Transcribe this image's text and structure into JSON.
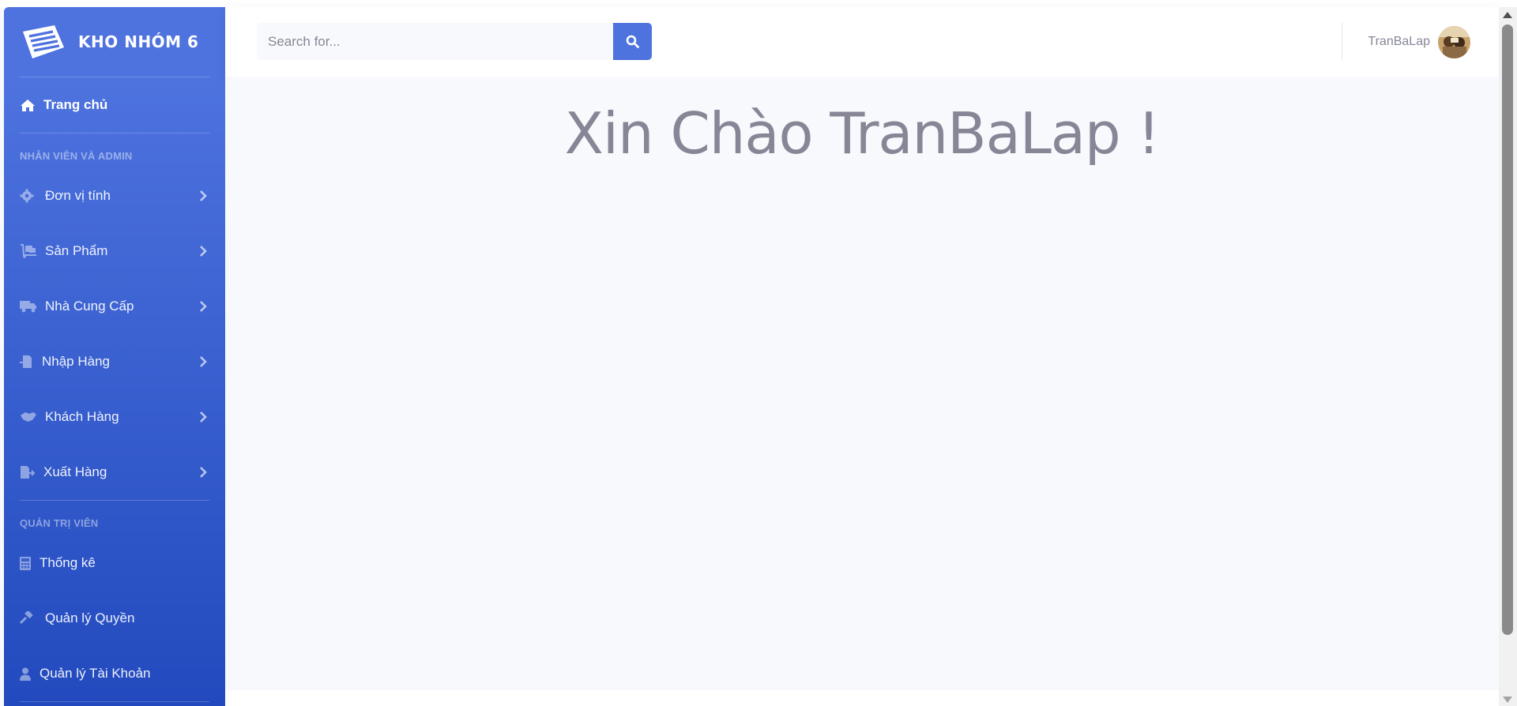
{
  "brand": {
    "name": "KHO NHÓM 6"
  },
  "nav": {
    "home": "Trang chủ",
    "section_staff": "NHÂN VIÊN VÀ ADMIN",
    "items": [
      {
        "label": "Đơn vị tính",
        "icon": "gear-icon"
      },
      {
        "label": "Sản Phẩm",
        "icon": "dolly-icon"
      },
      {
        "label": "Nhà Cung Cấp",
        "icon": "truck-icon"
      },
      {
        "label": "Nhập Hàng",
        "icon": "file-import-icon"
      },
      {
        "label": "Khách Hàng",
        "icon": "handshake-icon"
      },
      {
        "label": "Xuất Hàng",
        "icon": "file-export-icon"
      }
    ],
    "section_admin": "QUẢN TRỊ VIÊN",
    "admin_items": [
      {
        "label": "Thống kê",
        "icon": "calculator-icon"
      },
      {
        "label": "Quản lý Quyền",
        "icon": "gavel-icon"
      },
      {
        "label": "Quản lý Tài Khoản",
        "icon": "user-icon"
      }
    ]
  },
  "search": {
    "placeholder": "Search for..."
  },
  "user": {
    "name": "TranBaLap"
  },
  "main": {
    "greeting": "Xin Chào TranBaLap !"
  },
  "colors": {
    "primary": "#4e73df",
    "primary_dark": "#224abe",
    "text_muted": "#858796",
    "bg": "#f8f9fc"
  }
}
